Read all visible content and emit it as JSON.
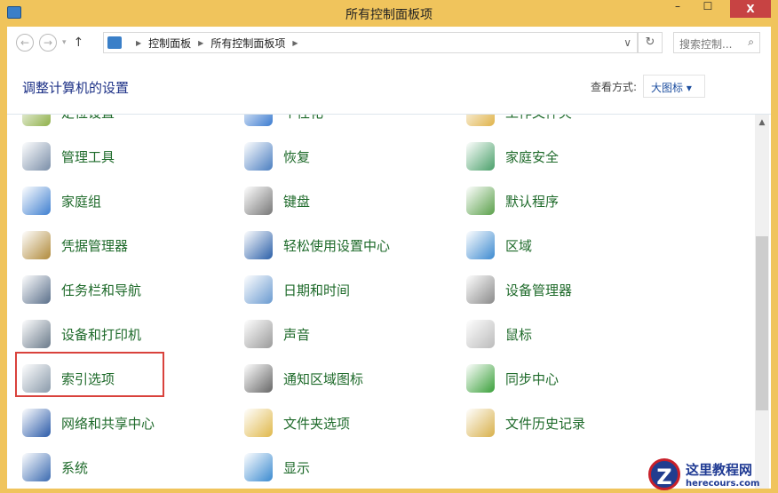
{
  "window": {
    "title": "所有控制面板项",
    "minimize": "–",
    "maximize": "☐",
    "close": "X"
  },
  "nav": {
    "back": "←",
    "forward": "→",
    "recent": "▾",
    "up": "↑"
  },
  "address": {
    "crumbs": [
      "控制面板",
      "所有控制面板项"
    ],
    "dropdown": "∨",
    "refresh": "↻"
  },
  "search": {
    "placeholder": "搜索控制...",
    "icon": "⌕"
  },
  "header": {
    "title": "调整计算机的设置",
    "view_label": "查看方式:",
    "view_value": "大图标 ▾"
  },
  "items": [
    [
      {
        "label": "定位设置",
        "color": "#8fb04a"
      },
      {
        "label": "个性化",
        "color": "#3b7bd0"
      },
      {
        "label": "工作文件夹",
        "color": "#e0b34a"
      }
    ],
    [
      {
        "label": "管理工具",
        "color": "#7a8ea8"
      },
      {
        "label": "恢复",
        "color": "#4a7ec0"
      },
      {
        "label": "家庭安全",
        "color": "#4aa06a"
      }
    ],
    [
      {
        "label": "家庭组",
        "color": "#3f7fd0"
      },
      {
        "label": "键盘",
        "color": "#777777"
      },
      {
        "label": "默认程序",
        "color": "#5aa04a"
      }
    ],
    [
      {
        "label": "凭据管理器",
        "color": "#b08a3a"
      },
      {
        "label": "轻松使用设置中心",
        "color": "#2a5fa8"
      },
      {
        "label": "区域",
        "color": "#3c8ad0"
      }
    ],
    [
      {
        "label": "任务栏和导航",
        "color": "#5a6f8a"
      },
      {
        "label": "日期和时间",
        "color": "#6a9ad0"
      },
      {
        "label": "设备管理器",
        "color": "#8a8a8a"
      }
    ],
    [
      {
        "label": "设备和打印机",
        "color": "#6a7a8a"
      },
      {
        "label": "声音",
        "color": "#9a9a9a"
      },
      {
        "label": "鼠标",
        "color": "#bbbbbb"
      }
    ],
    [
      {
        "label": "索引选项",
        "color": "#8a9aaa"
      },
      {
        "label": "通知区域图标",
        "color": "#666666"
      },
      {
        "label": "同步中心",
        "color": "#3aa03a"
      }
    ],
    [
      {
        "label": "网络和共享中心",
        "color": "#2a5aa8"
      },
      {
        "label": "文件夹选项",
        "color": "#e0b84a"
      },
      {
        "label": "文件历史记录",
        "color": "#d8b04a"
      }
    ],
    [
      {
        "label": "系统",
        "color": "#3a6ab0"
      },
      {
        "label": "显示",
        "color": "#3a8ad0"
      },
      {
        "label": "",
        "color": ""
      }
    ]
  ],
  "watermark": {
    "name": "这里教程网",
    "url": "herecours.com",
    "logo": "Z"
  }
}
